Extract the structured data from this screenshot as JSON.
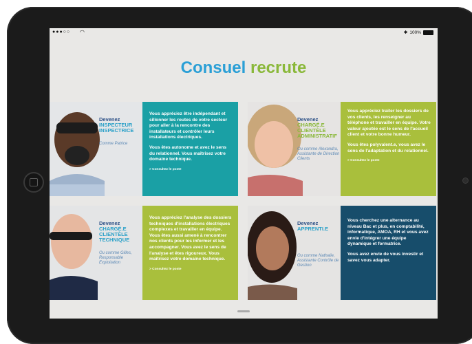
{
  "status": {
    "carrier": "●●●○○",
    "battery_text": "100%",
    "bluetooth": "✱"
  },
  "title": {
    "word1": "Consuel",
    "word2": "recrute"
  },
  "cards": [
    {
      "devenez": "Devenez",
      "role_lines": [
        "INSPECTEUR",
        "INSPECTRICE"
      ],
      "quote": "Comme Patrice",
      "paragraphs": [
        "Vous appréciez être indépendant et sillonner les routes de votre secteur pour aller à la rencontre des installateurs et contrôler leurs installations électriques.",
        "Vous êtes autonome et avez le sens du relationnel. Vous maîtrisez votre domaine technique."
      ],
      "cta": "> Consultez le poste"
    },
    {
      "devenez": "Devenez",
      "role_lines": [
        "CHARGÉ.E",
        "CLIENTÈLE",
        "ADMINISTRATIF"
      ],
      "quote": "Ou comme Alexandra, Assistante de Direction Clients",
      "paragraphs": [
        "Vous appréciez traiter les dossiers de vos clients, les renseigner au téléphone et travailler en équipe. Votre valeur ajoutée est le sens de l'accueil client et votre bonne humeur.",
        "Vous êtes polyvalent.e, vous avez le sens de l'adaptation et du relationnel."
      ],
      "cta": "> Consultez le poste"
    },
    {
      "devenez": "Devenez",
      "role_lines": [
        "CHARGÉ.E",
        "CLIENTÈLE",
        "TECHNIQUE"
      ],
      "quote": "Ou comme Gilles, Responsable Exploitation",
      "paragraphs": [
        "Vous appréciez l'analyse des dossiers techniques d'installations électriques complexes et travailler en équipe. Vous êtes aussi amené à rencontrer nos clients pour les informer et les accompagner. Vous avez le sens de l'analyse et êtes rigoureux. Vous maîtrisez votre domaine technique."
      ],
      "cta": "> Consultez le poste"
    },
    {
      "devenez": "Devenez",
      "role_lines": [
        "APPRENTI.E"
      ],
      "quote": "Ou comme Nathalie, Assistante Contrôle de Gestion",
      "paragraphs": [
        "Vous cherchez une alternance au niveau Bac et plus, en comptabilité, informatique, AMOA, RH et vous avez envie d'intégrer une équipe dynamique et formatrice.",
        "Vous avez envie de vous investir et savez vous adapter."
      ],
      "cta": ""
    }
  ],
  "colors": {
    "teal": "#1aa0a5",
    "lime": "#a9bf3c",
    "navy": "#174d6b",
    "blue_title": "#2a9fd6",
    "green_title": "#8ab83a"
  }
}
